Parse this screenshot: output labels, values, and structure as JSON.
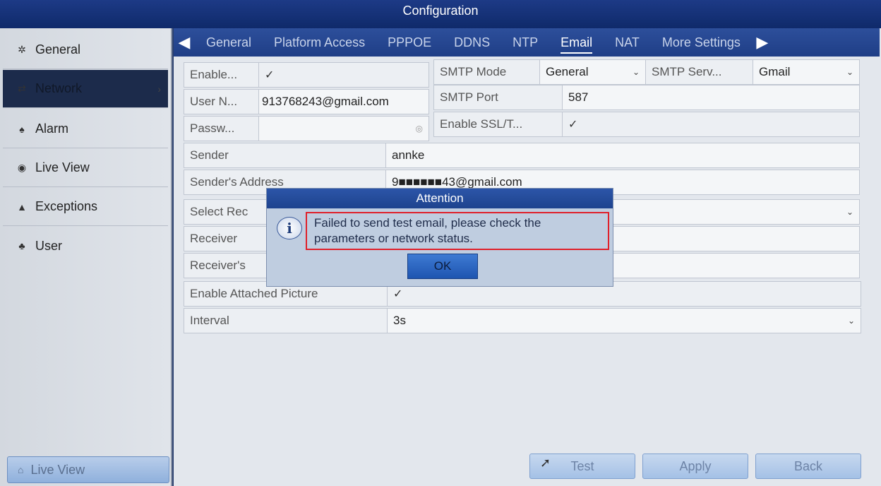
{
  "window": {
    "title": "Configuration"
  },
  "sidebar": {
    "items": [
      {
        "label": "General",
        "icon": "gear-icon"
      },
      {
        "label": "Network",
        "icon": "network-icon",
        "active": true
      },
      {
        "label": "Alarm",
        "icon": "alarm-icon"
      },
      {
        "label": "Live View",
        "icon": "eye-icon"
      },
      {
        "label": "Exceptions",
        "icon": "warning-icon"
      },
      {
        "label": "User",
        "icon": "users-icon"
      }
    ],
    "bottom_button": "Live View"
  },
  "tabs": [
    "General",
    "Platform Access",
    "PPPOE",
    "DDNS",
    "NTP",
    "Email",
    "NAT",
    "More Settings"
  ],
  "active_tab": "Email",
  "form": {
    "enable_label": "Enable...",
    "enable_checked": "✓",
    "username_label": "User N...",
    "username_value": "913768243@gmail.com",
    "password_label": "Passw...",
    "smtp_mode_label": "SMTP Mode",
    "smtp_mode_value": "General",
    "smtp_server_label": "SMTP Serv...",
    "smtp_server_value": "Gmail",
    "smtp_port_label": "SMTP Port",
    "smtp_port_value": "587",
    "ssl_label": "Enable SSL/T...",
    "ssl_checked": "✓",
    "sender_label": "Sender",
    "sender_value": "annke",
    "sender_address_label": "Sender's Address",
    "sender_address_value": "9■■■■■■43@gmail.com",
    "select_receiver_label": "Select Rec",
    "receiver_label": "Receiver",
    "receiver_address_label": "Receiver's",
    "attached_picture_label": "Enable Attached Picture",
    "attached_picture_checked": "✓",
    "interval_label": "Interval",
    "interval_value": "3s"
  },
  "buttons": {
    "test": "Test",
    "apply": "Apply",
    "back": "Back"
  },
  "dialog": {
    "title": "Attention",
    "message": "Failed to send test email, please check the parameters or network status.",
    "ok": "OK"
  }
}
